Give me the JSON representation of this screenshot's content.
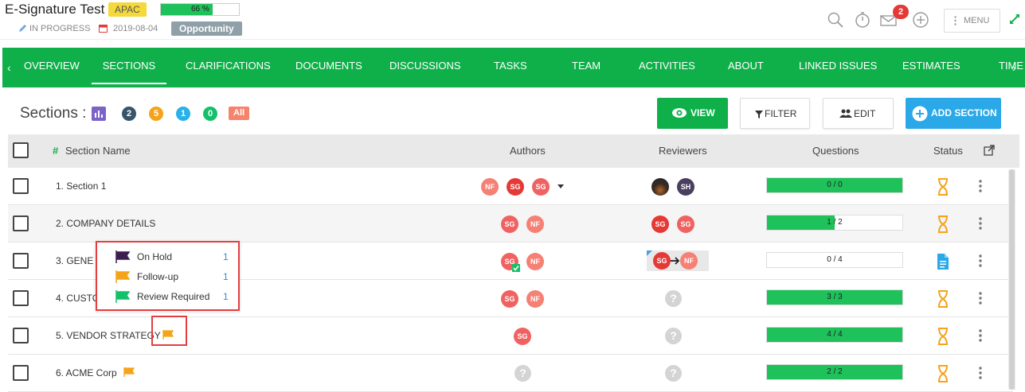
{
  "header": {
    "title": "E-Signature Test",
    "region": "APAC",
    "progress_text": "66 %",
    "progress_value": 0.66,
    "status": "IN PROGRESS",
    "date": "2019-08-04",
    "type": "Opportunity",
    "notification_count": "2",
    "menu_label": "MENU"
  },
  "nav": {
    "tabs": [
      "OVERVIEW",
      "SECTIONS",
      "CLARIFICATIONS",
      "DOCUMENTS",
      "DISCUSSIONS",
      "TASKS",
      "TEAM",
      "ACTIVITIES",
      "ABOUT",
      "LINKED ISSUES",
      "ESTIMATES",
      "TIME"
    ],
    "active": "SECTIONS"
  },
  "toolbar": {
    "heading": "Sections :",
    "counts": [
      {
        "value": "2",
        "color": "#37546b"
      },
      {
        "value": "5",
        "color": "#f5a31a"
      },
      {
        "value": "1",
        "color": "#29b1ea"
      },
      {
        "value": "0",
        "color": "#13c16a"
      }
    ],
    "all_label": "All",
    "view_label": "VIEW",
    "filter_label": "FILTER",
    "edit_label": "EDIT",
    "add_label": "ADD SECTION"
  },
  "table": {
    "headers": {
      "name": "Section Name",
      "authors": "Authors",
      "reviewers": "Reviewers",
      "questions": "Questions",
      "status": "Status"
    },
    "rows": [
      {
        "name": "1. Section 1",
        "authors": [
          "NF",
          "SG",
          "SG"
        ],
        "reviewers": [
          "",
          "SH"
        ],
        "questions": "0 / 0",
        "q_fill": 1.0,
        "status": "hourglass"
      },
      {
        "name": "2. COMPANY DETAILS",
        "authors": [
          "SG",
          "NF"
        ],
        "reviewers": [
          "SG",
          "SG"
        ],
        "questions": "1 / 2",
        "q_fill": 0.5,
        "status": "hourglass"
      },
      {
        "name": "3. GENE",
        "authors": [
          "SG",
          "NF"
        ],
        "reviewers": [
          "SG",
          "NF"
        ],
        "questions": "0 / 4",
        "q_fill": 0.0,
        "status": "document"
      },
      {
        "name": "4. CUSTO",
        "authors": [
          "SG",
          "NF"
        ],
        "reviewers": [],
        "questions": "3 / 3",
        "q_fill": 1.0,
        "status": "hourglass"
      },
      {
        "name": "5. VENDOR STRATEGY",
        "authors": [
          "SG"
        ],
        "reviewers": [],
        "questions": "4 / 4",
        "q_fill": 1.0,
        "status": "hourglass"
      },
      {
        "name": "6. ACME Corp",
        "authors": [],
        "reviewers": [],
        "questions": "2 / 2",
        "q_fill": 1.0,
        "status": "hourglass"
      }
    ]
  },
  "flag_popup": {
    "items": [
      {
        "label": "On Hold",
        "count": "1",
        "color": "#3b1f4f"
      },
      {
        "label": "Follow-up",
        "count": "1",
        "color": "#f5a31a"
      },
      {
        "label": "Review Required",
        "count": "1",
        "color": "#13c16a"
      }
    ]
  },
  "colors": {
    "accent_green": "#0fb04a",
    "bar_green": "#1ec15a",
    "blue": "#2aa8e8",
    "hourglass": "#f5a31a"
  }
}
